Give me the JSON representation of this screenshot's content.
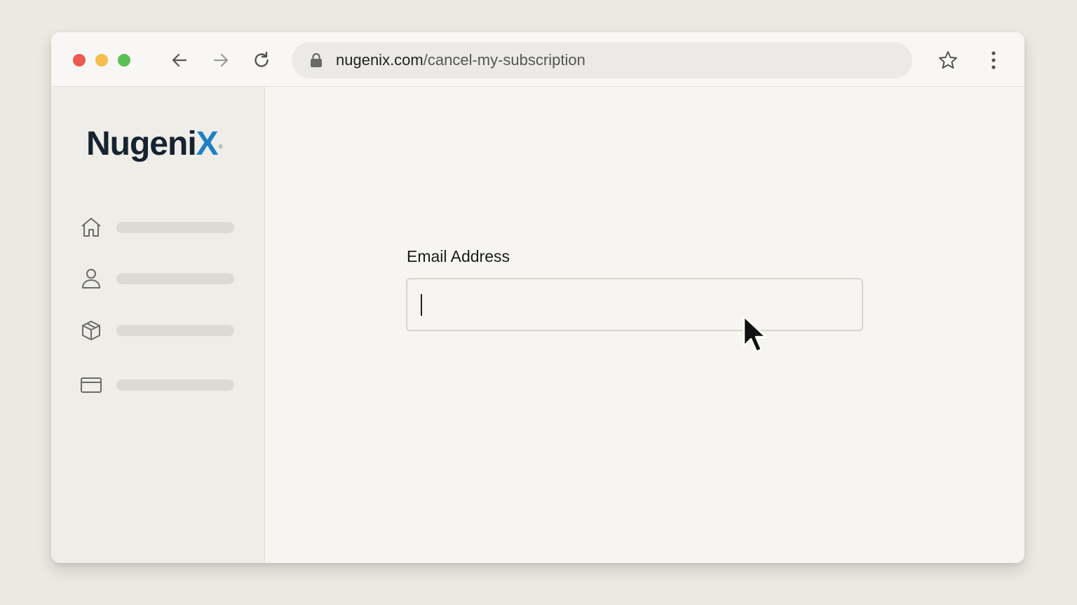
{
  "window": {
    "traffic_lights": {
      "close": "#ec5a51",
      "minimize": "#f4be4f",
      "zoom": "#5cbf55"
    }
  },
  "toolbar": {
    "back_icon": "arrow-left-icon",
    "forward_icon": "arrow-right-icon",
    "reload_icon": "reload-icon",
    "url_domain": "nugenix.com",
    "url_path": "/cancel-my-subscription",
    "bookmark_icon": "star-icon",
    "menu_icon": "kebab-menu-icon"
  },
  "sidebar": {
    "logo_main": "Nugeni",
    "logo_x": "X",
    "logo_reg": "®",
    "logo_accent": "#1f7fc6",
    "items": [
      {
        "icon": "home-icon"
      },
      {
        "icon": "user-icon"
      },
      {
        "icon": "box-icon"
      },
      {
        "icon": "credit-card-icon"
      }
    ]
  },
  "form": {
    "email_label": "Email Address",
    "email_value": "",
    "email_placeholder": ""
  }
}
